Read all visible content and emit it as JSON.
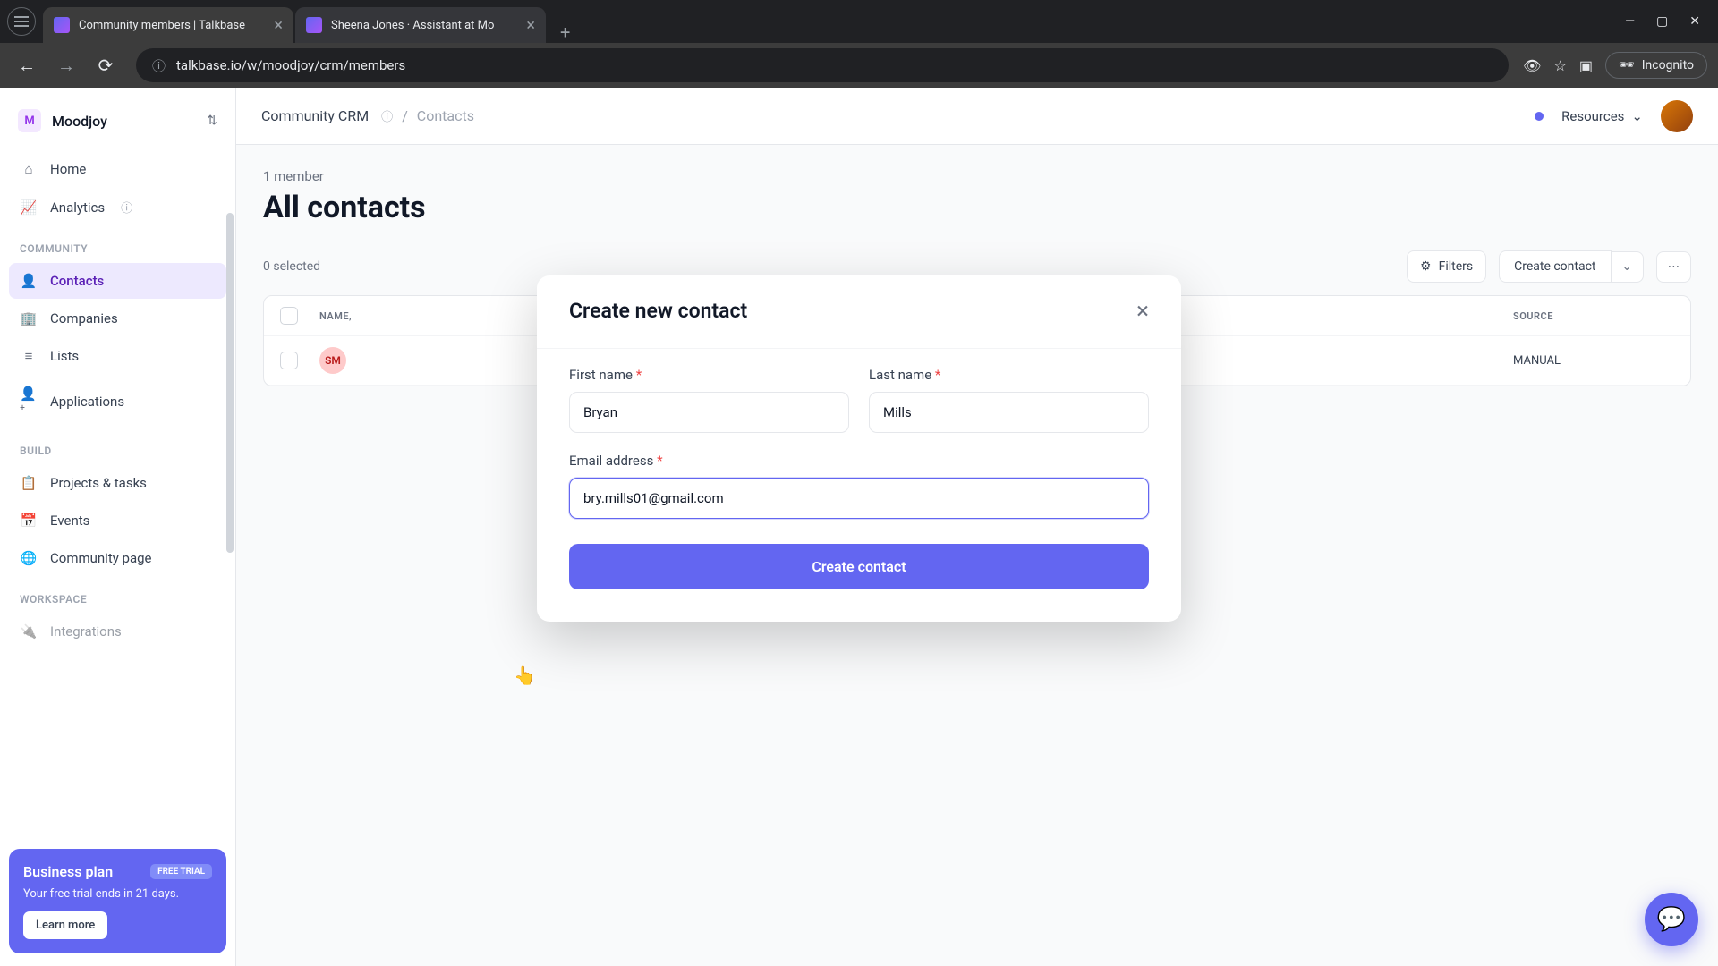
{
  "tabs": [
    {
      "title": "Community members | Talkbase"
    },
    {
      "title": "Sheena Jones · Assistant at Mo"
    }
  ],
  "url": "talkbase.io/w/moodjoy/crm/members",
  "incognito_label": "Incognito",
  "workspace": {
    "initial": "M",
    "name": "Moodjoy"
  },
  "nav": {
    "home": "Home",
    "analytics": "Analytics",
    "section_community": "COMMUNITY",
    "contacts": "Contacts",
    "companies": "Companies",
    "lists": "Lists",
    "applications": "Applications",
    "section_build": "BUILD",
    "projects": "Projects & tasks",
    "events": "Events",
    "community_page": "Community page",
    "section_workspace": "WORKSPACE",
    "integrations": "Integrations"
  },
  "plan": {
    "title": "Business plan",
    "badge": "FREE TRIAL",
    "text": "Your free trial ends in 21 days.",
    "btn": "Learn more"
  },
  "breadcrumb": {
    "root": "Community CRM",
    "current": "Contacts"
  },
  "resources_label": "Resources",
  "content": {
    "member_count": "1 member",
    "page_title": "All contacts",
    "selected": "0 selected",
    "filters": "Filters",
    "create_contact": "Create contact"
  },
  "table": {
    "col_name": "NAME,",
    "col_source": "SOURCE",
    "row1": {
      "initials": "SM",
      "source": "MANUAL"
    }
  },
  "modal": {
    "title": "Create new contact",
    "first_name_label": "First name",
    "first_name_value": "Bryan",
    "last_name_label": "Last name",
    "last_name_value": "Mills",
    "email_label": "Email address",
    "email_value": "bry.mills01@gmail.com",
    "submit": "Create contact"
  }
}
